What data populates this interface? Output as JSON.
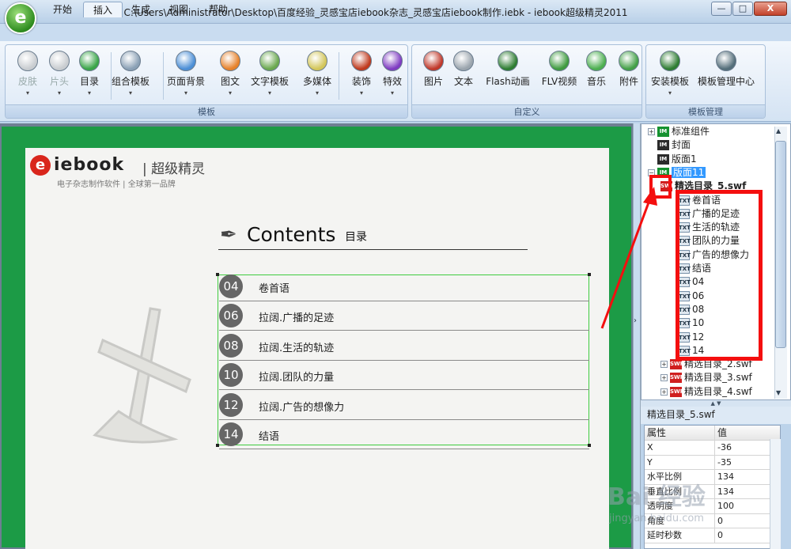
{
  "app": {
    "title": "C:\\Users\\Administrator\\Desktop\\百度经验_灵感宝店iebook杂志_灵感宝店iebook制作.iebk - iebook超级精灵2011",
    "logo_glyph": "e"
  },
  "window_controls": {
    "minimize": "—",
    "maximize": "□",
    "close": "X"
  },
  "tabs": [
    {
      "label": "开始",
      "active": false
    },
    {
      "label": "插入",
      "active": true
    },
    {
      "label": "生成",
      "active": false
    },
    {
      "label": "视图",
      "active": false
    },
    {
      "label": "帮助",
      "active": false
    }
  ],
  "ribbon": {
    "groups": [
      {
        "label": "模板"
      },
      {
        "label": "自定义"
      },
      {
        "label": "模板管理"
      }
    ],
    "buttons": [
      {
        "label": "皮肤",
        "icon": "skin-icon",
        "dropdown": "▾",
        "color": "#c8ccd0",
        "disabled": true
      },
      {
        "label": "片头",
        "icon": "intro-icon",
        "dropdown": "▾",
        "color": "#c8ccd0",
        "disabled": true
      },
      {
        "label": "目录",
        "icon": "catalog-icon",
        "dropdown": "▾",
        "color": "#3aa548",
        "disabled": false
      },
      {
        "label": "组合模板",
        "icon": "combo-template-icon",
        "dropdown": "▾",
        "color": "#8aa0b5",
        "disabled": false
      },
      {
        "label": "页面背景",
        "icon": "page-background-icon",
        "dropdown": "▾",
        "color": "#4c8fd6",
        "disabled": false
      },
      {
        "label": "图文",
        "icon": "image-text-icon",
        "dropdown": "▾",
        "color": "#e6812a",
        "disabled": false
      },
      {
        "label": "文字模板",
        "icon": "text-template-icon",
        "dropdown": "▾",
        "color": "#6aa84f",
        "disabled": false
      },
      {
        "label": "多媒体",
        "icon": "multimedia-icon",
        "dropdown": "▾",
        "color": "#d3c65a",
        "disabled": false
      },
      {
        "label": "装饰",
        "icon": "decoration-icon",
        "dropdown": "▾",
        "color": "#c03a1e",
        "disabled": false
      },
      {
        "label": "特效",
        "icon": "effects-icon",
        "dropdown": "▾",
        "color": "#7f3bc2",
        "disabled": false
      },
      {
        "label": "图片",
        "icon": "picture-icon",
        "dropdown": "",
        "color": "#c0392b",
        "disabled": false
      },
      {
        "label": "文本",
        "icon": "text-icon",
        "dropdown": "",
        "color": "#9aa4ad",
        "disabled": false
      },
      {
        "label": "Flash动画",
        "icon": "flash-icon",
        "dropdown": "",
        "color": "#2e7d32",
        "disabled": false
      },
      {
        "label": "FLV视频",
        "icon": "flv-video-icon",
        "dropdown": "",
        "color": "#3f9b3f",
        "disabled": false
      },
      {
        "label": "音乐",
        "icon": "music-icon",
        "dropdown": "",
        "color": "#4caf50",
        "disabled": false
      },
      {
        "label": "附件",
        "icon": "attachment-icon",
        "dropdown": "",
        "color": "#43a047",
        "disabled": false
      },
      {
        "label": "安装模板",
        "icon": "install-template-icon",
        "dropdown": "▾",
        "color": "#2e7d32",
        "disabled": false
      },
      {
        "label": "模板管理中心",
        "icon": "template-center-icon",
        "dropdown": "",
        "color": "#546e7a",
        "disabled": false
      }
    ]
  },
  "page": {
    "logo_word": "iebook",
    "logo_cn": "| 超级精灵",
    "logo_sub": "电子杂志制作软件  |  全球第一品牌",
    "contents_title": "Contents",
    "contents_cn": "目录",
    "toc": [
      {
        "num": "04",
        "text": "卷首语"
      },
      {
        "num": "06",
        "text": "拉阔.广播的足迹"
      },
      {
        "num": "08",
        "text": "拉阔.生活的轨迹"
      },
      {
        "num": "10",
        "text": "拉阔.团队的力量"
      },
      {
        "num": "12",
        "text": "拉阔.广告的想像力"
      },
      {
        "num": "14",
        "text": "结语"
      }
    ]
  },
  "tree": {
    "nodes": [
      {
        "label": "标准组件",
        "icon": "green",
        "expander": "+",
        "indent": 0,
        "selected": false,
        "bold": false
      },
      {
        "label": "封面",
        "icon": "dark",
        "expander": "",
        "indent": 0,
        "selected": false,
        "bold": false
      },
      {
        "label": "版面1",
        "icon": "dark",
        "expander": "",
        "indent": 0,
        "selected": false,
        "bold": false
      },
      {
        "label": "版面11",
        "icon": "green",
        "expander": "−",
        "indent": 0,
        "selected": true,
        "bold": false
      },
      {
        "label": "精选目录_5.swf",
        "icon": "swf",
        "expander": "",
        "indent": 1,
        "selected": false,
        "bold": true
      },
      {
        "label": "卷首语",
        "icon": "txt",
        "expander": "",
        "indent": 2,
        "selected": false,
        "bold": false
      },
      {
        "label": "广播的足迹",
        "icon": "txt",
        "expander": "",
        "indent": 2,
        "selected": false,
        "bold": false
      },
      {
        "label": "生活的轨迹",
        "icon": "txt",
        "expander": "",
        "indent": 2,
        "selected": false,
        "bold": false
      },
      {
        "label": "团队的力量",
        "icon": "txt",
        "expander": "",
        "indent": 2,
        "selected": false,
        "bold": false
      },
      {
        "label": "广告的想像力",
        "icon": "txt",
        "expander": "",
        "indent": 2,
        "selected": false,
        "bold": false
      },
      {
        "label": "结语",
        "icon": "txt",
        "expander": "",
        "indent": 2,
        "selected": false,
        "bold": false
      },
      {
        "label": "04",
        "icon": "txt",
        "expander": "",
        "indent": 2,
        "selected": false,
        "bold": false
      },
      {
        "label": "06",
        "icon": "txt",
        "expander": "",
        "indent": 2,
        "selected": false,
        "bold": false
      },
      {
        "label": "08",
        "icon": "txt",
        "expander": "",
        "indent": 2,
        "selected": false,
        "bold": false
      },
      {
        "label": "10",
        "icon": "txt",
        "expander": "",
        "indent": 2,
        "selected": false,
        "bold": false
      },
      {
        "label": "12",
        "icon": "txt",
        "expander": "",
        "indent": 2,
        "selected": false,
        "bold": false
      },
      {
        "label": "14",
        "icon": "txt",
        "expander": "",
        "indent": 2,
        "selected": false,
        "bold": false
      },
      {
        "label": "精选目录_2.swf",
        "icon": "swf",
        "expander": "+",
        "indent": 1,
        "selected": false,
        "bold": false
      },
      {
        "label": "精选目录_3.swf",
        "icon": "swf",
        "expander": "+",
        "indent": 1,
        "selected": false,
        "bold": false
      },
      {
        "label": "精选目录_4.swf",
        "icon": "swf",
        "expander": "+",
        "indent": 1,
        "selected": false,
        "bold": false
      }
    ]
  },
  "properties": {
    "title": "精选目录_5.swf",
    "header_name": "属性",
    "header_value": "值",
    "rows": [
      {
        "name": "X",
        "value": "-36"
      },
      {
        "name": "Y",
        "value": "-35"
      },
      {
        "name": "水平比例",
        "value": "134"
      },
      {
        "name": "垂直比例",
        "value": "134"
      },
      {
        "name": "透明度",
        "value": "100"
      },
      {
        "name": "角度",
        "value": "0"
      },
      {
        "name": "延时秒数",
        "value": "0"
      }
    ]
  },
  "watermark": {
    "main": "Bai 经验",
    "sub": "jingyan.baidu.com"
  },
  "colors": {
    "canvas_green": "#1c9b46",
    "highlight_red": "#f40f0f",
    "selection_blue": "#3399ff"
  }
}
